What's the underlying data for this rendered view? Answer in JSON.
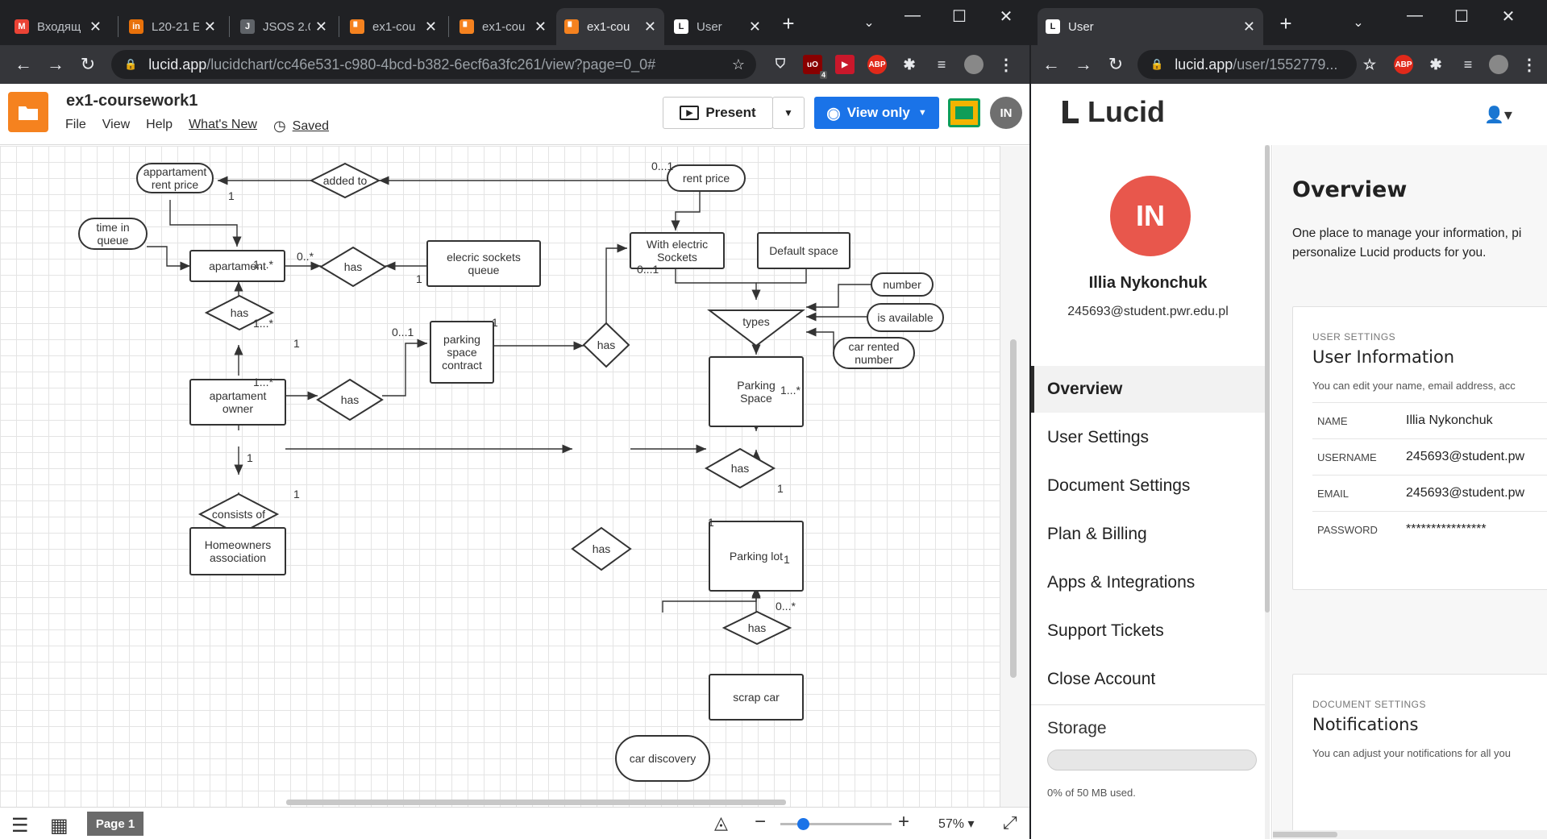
{
  "left_browser": {
    "tabs": [
      {
        "title": "Входящ",
        "icon": "gmail-icon"
      },
      {
        "title": "L20-21 E",
        "icon": "indeed-icon"
      },
      {
        "title": "JSOS 2.0",
        "icon": "jsos-icon"
      },
      {
        "title": "ex1-cou",
        "icon": "lucid-doc-icon"
      },
      {
        "title": "ex1-cou",
        "icon": "lucid-doc-icon"
      },
      {
        "title": "ex1-cou",
        "icon": "lucid-doc-icon"
      },
      {
        "title": "User",
        "icon": "lucid-icon"
      }
    ],
    "url_host": "lucid.app",
    "url_path": "/lucidchart/cc46e531-c980-4bcd-b382-6ecf6a3fc261/view?page=0_0#",
    "ext_badge": "4"
  },
  "chart_app": {
    "doc_title": "ex1-coursework1",
    "menu": [
      "File",
      "View",
      "Help",
      "What's New"
    ],
    "saved_label": "Saved",
    "present_label": "Present",
    "view_only_label": "View only",
    "avatar_initials": "IN",
    "page_tab": "Page 1",
    "zoom": "57%",
    "zoom_slider_fraction": 0.2
  },
  "diagram": {
    "nodes": [
      {
        "id": "app_rent_price",
        "shape": "oval",
        "lines": [
          "appartament",
          "rent price"
        ]
      },
      {
        "id": "added_to",
        "shape": "diamond",
        "lines": [
          "added to"
        ]
      },
      {
        "id": "rent_price",
        "shape": "oval",
        "lines": [
          "rent price"
        ]
      },
      {
        "id": "time_queue",
        "shape": "oval",
        "lines": [
          "time in",
          "queue"
        ]
      },
      {
        "id": "apartament",
        "shape": "rect",
        "lines": [
          "apartament"
        ]
      },
      {
        "id": "has1",
        "shape": "diamond",
        "lines": [
          "has"
        ]
      },
      {
        "id": "elec_queue",
        "shape": "rect",
        "lines": [
          "elecric sockets",
          "queue"
        ]
      },
      {
        "id": "with_elec",
        "shape": "rect",
        "lines": [
          "With electric",
          "Sockets"
        ]
      },
      {
        "id": "default_space",
        "shape": "rect",
        "lines": [
          "Default space"
        ]
      },
      {
        "id": "has2",
        "shape": "diamond",
        "lines": [
          "has"
        ]
      },
      {
        "id": "parking_contract",
        "shape": "rect",
        "lines": [
          "parking",
          "space",
          "contract"
        ]
      },
      {
        "id": "has3",
        "shape": "diamond",
        "lines": [
          "has"
        ]
      },
      {
        "id": "types",
        "shape": "triangle",
        "lines": [
          "types"
        ]
      },
      {
        "id": "number",
        "shape": "oval",
        "lines": [
          "number"
        ]
      },
      {
        "id": "is_available",
        "shape": "oval",
        "lines": [
          "is available"
        ]
      },
      {
        "id": "car_rented",
        "shape": "oval",
        "lines": [
          "car rented",
          "number"
        ]
      },
      {
        "id": "parking_space",
        "shape": "rect",
        "lines": [
          "Parking",
          "Space"
        ]
      },
      {
        "id": "apt_owner",
        "shape": "rect",
        "lines": [
          "apartament",
          "owner"
        ]
      },
      {
        "id": "has4",
        "shape": "diamond",
        "lines": [
          "has"
        ]
      },
      {
        "id": "has5",
        "shape": "diamond",
        "lines": [
          "has"
        ]
      },
      {
        "id": "consists_of",
        "shape": "diamond",
        "lines": [
          "consists of"
        ]
      },
      {
        "id": "homeowners",
        "shape": "rect",
        "lines": [
          "Homeowners",
          "association"
        ]
      },
      {
        "id": "has6",
        "shape": "diamond",
        "lines": [
          "has"
        ]
      },
      {
        "id": "parking_lot",
        "shape": "rect",
        "lines": [
          "Parking lot"
        ]
      },
      {
        "id": "has7",
        "shape": "diamond",
        "lines": [
          "has"
        ]
      },
      {
        "id": "scrap_car",
        "shape": "rect",
        "lines": [
          "scrap car"
        ]
      },
      {
        "id": "car_discovery",
        "shape": "oval",
        "lines": [
          "car discovery"
        ]
      }
    ],
    "labels": [
      "0...1",
      "1",
      "0..*",
      "1",
      "1...*",
      "1...*",
      "0...1",
      "1",
      "0...1",
      "1",
      "1...*",
      "1...*",
      "1",
      "1",
      "1",
      "1",
      "1",
      "0...*"
    ]
  },
  "right_browser": {
    "tab_title": "User",
    "url_host": "lucid.app",
    "url_path": "/user/1552779..."
  },
  "user_page": {
    "brand": "Lucid",
    "avatar_initials": "IN",
    "name": "Illia Nykonchuk",
    "email": "245693@student.pwr.edu.pl",
    "nav": [
      "Overview",
      "User Settings",
      "Document Settings",
      "Plan & Billing",
      "Apps & Integrations",
      "Support Tickets",
      "Close Account"
    ],
    "storage_label": "Storage",
    "storage_used_fraction": 0.0,
    "storage_text": "0% of 50 MB used.",
    "overview_title": "Overview",
    "overview_desc": "One place to manage your information, pi personalize Lucid products for you.",
    "user_settings_section": "USER SETTINGS",
    "user_info_title": "User Information",
    "user_info_desc": "You can edit your name, email address, acc",
    "fields": [
      {
        "key": "NAME",
        "value": "Illia Nykonchuk"
      },
      {
        "key": "USERNAME",
        "value": "245693@student.pw"
      },
      {
        "key": "EMAIL",
        "value": "245693@student.pw"
      },
      {
        "key": "PASSWORD",
        "value": "****************"
      }
    ],
    "doc_settings_section": "DOCUMENT SETTINGS",
    "notifications_title": "Notifications",
    "notifications_desc": "You can adjust your notifications for all you"
  },
  "colors": {
    "lucid_orange": "#f5821f",
    "view_only_blue": "#1a73e8",
    "avatar_red": "#e8574c",
    "chrome_dark": "#202124"
  }
}
